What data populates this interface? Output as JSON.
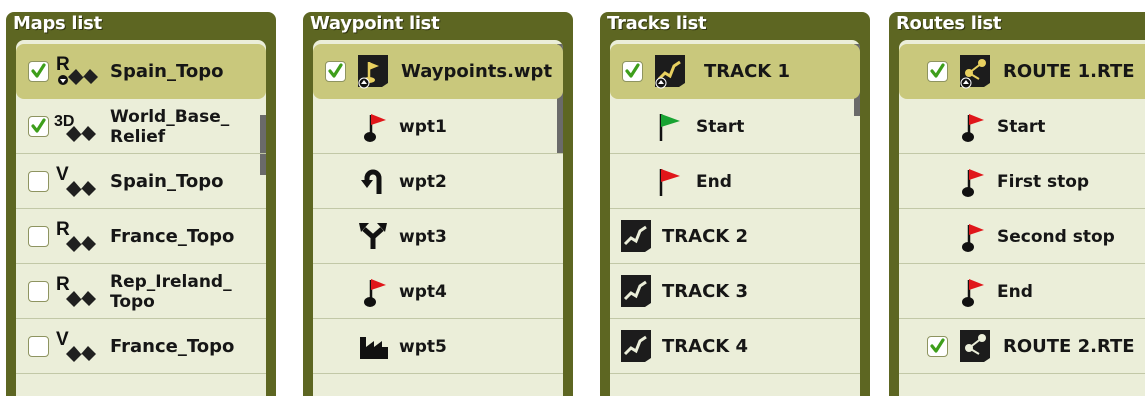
{
  "maps": {
    "title": "Maps list",
    "items": [
      {
        "label": "Spain_Topo",
        "prefix": "R",
        "checked": true,
        "selected": true,
        "icon": "raster-map-icon"
      },
      {
        "label": "World_Base_ Relief",
        "prefix": "3D",
        "checked": true,
        "selected": false,
        "icon": "relief-map-icon"
      },
      {
        "label": "Spain_Topo",
        "prefix": "V",
        "checked": false,
        "selected": false,
        "icon": "vector-map-icon"
      },
      {
        "label": "France_Topo",
        "prefix": "R",
        "checked": false,
        "selected": false,
        "icon": "raster-map-icon"
      },
      {
        "label": "Rep_Ireland_ Topo",
        "prefix": "R",
        "checked": false,
        "selected": false,
        "icon": "raster-map-icon"
      },
      {
        "label": "France_Topo",
        "prefix": "V",
        "checked": false,
        "selected": false,
        "icon": "vector-map-icon"
      }
    ]
  },
  "waypoints": {
    "title": "Waypoint list",
    "items": [
      {
        "label": "Waypoints.wpt",
        "checked": true,
        "selected": true,
        "icon": "waypoint-file-icon"
      },
      {
        "label": "wpt1",
        "icon": "red-flag-icon"
      },
      {
        "label": "wpt2",
        "icon": "u-turn-arrow-icon"
      },
      {
        "label": "wpt3",
        "icon": "fork-arrow-icon"
      },
      {
        "label": "wpt4",
        "icon": "red-flag-icon"
      },
      {
        "label": "wpt5",
        "icon": "factory-icon"
      }
    ]
  },
  "tracks": {
    "title": "Tracks list",
    "items": [
      {
        "label": "TRACK 1",
        "checked": true,
        "selected": true,
        "icon": "track-file-icon"
      },
      {
        "label": "Start",
        "icon": "green-flag-icon"
      },
      {
        "label": "End",
        "icon": "red-flag-icon"
      },
      {
        "label": "TRACK 2",
        "icon": "track-file-icon"
      },
      {
        "label": "TRACK 3",
        "icon": "track-file-icon"
      },
      {
        "label": "TRACK 4",
        "icon": "track-file-icon"
      }
    ]
  },
  "routes": {
    "title": "Routes list",
    "items": [
      {
        "label": "ROUTE 1.RTE",
        "checked": true,
        "selected": true,
        "icon": "route-file-icon"
      },
      {
        "label": "Start",
        "icon": "red-flag-icon"
      },
      {
        "label": "First stop",
        "icon": "red-flag-icon"
      },
      {
        "label": "Second stop",
        "icon": "red-flag-icon"
      },
      {
        "label": "End",
        "icon": "red-flag-icon"
      },
      {
        "label": "ROUTE 2.RTE",
        "checked": true,
        "selected": false,
        "icon": "route-file-icon"
      }
    ]
  },
  "colors": {
    "panel_frame": "#5d6622",
    "list_background": "#ebeed9",
    "selected_row": "#c9c87c",
    "check_green": "#3e9e1b",
    "flag_red": "#e0161a",
    "flag_green": "#18a332"
  }
}
